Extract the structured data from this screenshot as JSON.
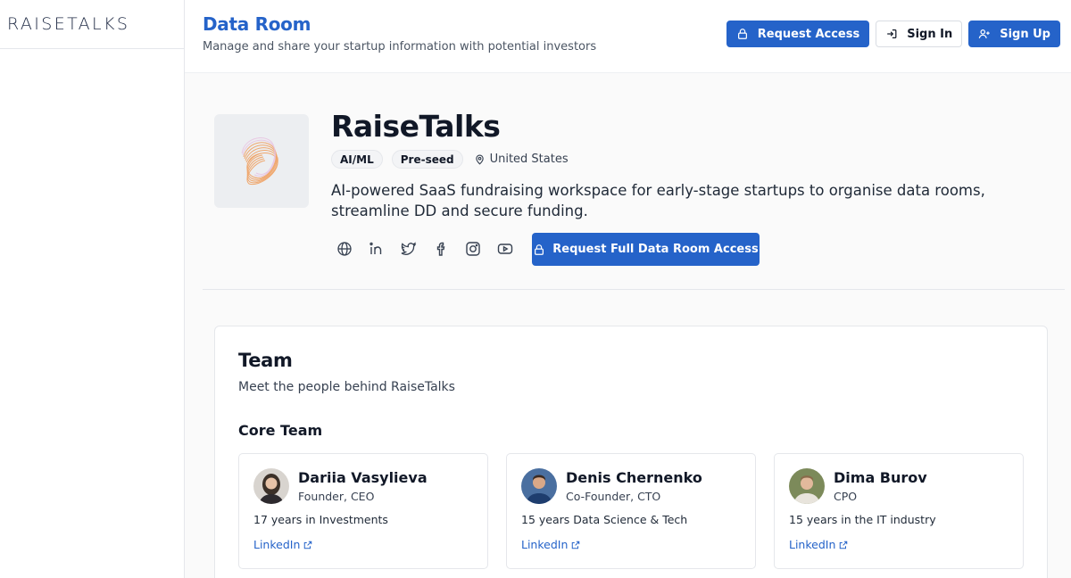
{
  "brand": {
    "logo_text": "RAISETALKS"
  },
  "header": {
    "title": "Data Room",
    "subtitle": "Manage and share your startup information with potential investors",
    "request_access_label": "Request Access",
    "sign_in_label": "Sign In",
    "sign_up_label": "Sign Up"
  },
  "company": {
    "name": "RaiseTalks",
    "tags": [
      "AI/ML",
      "Pre-seed"
    ],
    "location": "United States",
    "description": "AI-powered SaaS fundraising workspace for early-stage startups to organise data rooms, streamline DD and secure funding.",
    "socials": [
      "globe-icon",
      "linkedin-icon",
      "twitter-icon",
      "facebook-icon",
      "instagram-icon",
      "youtube-icon"
    ],
    "request_full_label": "Request Full Data Room Access"
  },
  "team": {
    "title": "Team",
    "subtitle": "Meet the people behind RaiseTalks",
    "core_title": "Core Team",
    "members": [
      {
        "name": "Dariia Vasylieva",
        "role": "Founder, CEO",
        "experience": "17 years in Investments",
        "link_label": "LinkedIn"
      },
      {
        "name": "Denis Chernenko",
        "role": "Co-Founder, CTO",
        "experience": "15 years Data Science & Tech",
        "link_label": "LinkedIn"
      },
      {
        "name": "Dima Burov",
        "role": "CPO",
        "experience": "15 years in the IT industry",
        "link_label": "LinkedIn"
      }
    ]
  },
  "colors": {
    "accent": "#2563c9",
    "text": "#111827",
    "border": "#e5e7eb"
  }
}
